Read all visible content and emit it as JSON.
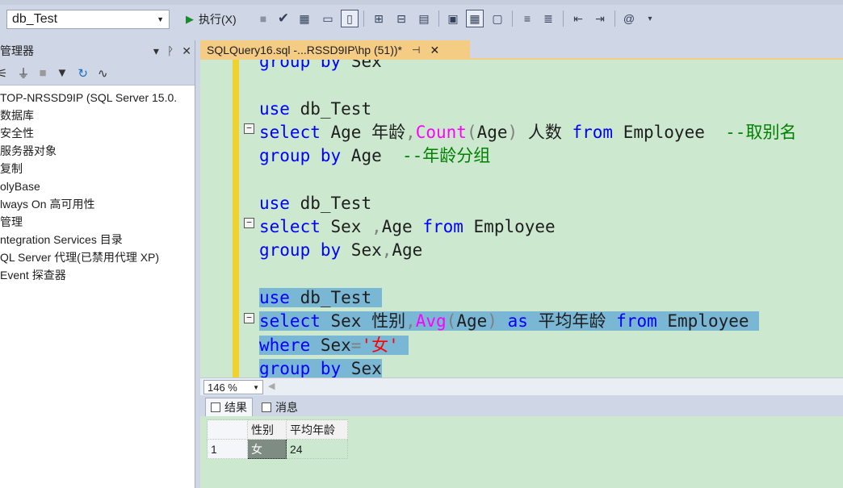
{
  "toolbar": {
    "database": "db_Test",
    "execute_label": "执行(X)"
  },
  "explorer": {
    "title": "管理器",
    "items": [
      "TOP-NRSSD9IP (SQL Server 15.0.",
      "数据库",
      "安全性",
      "服务器对象",
      "复制",
      "olyBase",
      "lways On 高可用性",
      "管理",
      "ntegration Services 目录",
      "QL Server 代理(已禁用代理 XP)",
      "Event 探查器"
    ]
  },
  "doc_tab": {
    "title": "SQLQuery16.sql -...RSSD9IP\\hp (51))*"
  },
  "editor": {
    "zoom": "146 %"
  },
  "results": {
    "tab_results": "结果",
    "tab_messages": "消息",
    "columns": [
      "性别",
      "平均年龄"
    ],
    "rows": [
      {
        "num": "1",
        "gender": "女",
        "avg_age": "24"
      }
    ]
  },
  "colors": {
    "editor_bg": "#cce8cf",
    "selection": "#7ab7d4",
    "keyword": "#0000ff",
    "function": "#ff00ff",
    "comment": "#008000",
    "string": "#ff0000",
    "active_tab": "#f5cc84"
  }
}
